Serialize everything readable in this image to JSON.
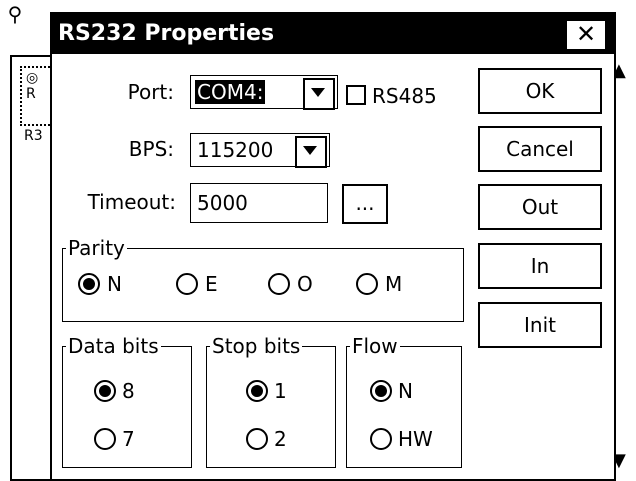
{
  "dialog": {
    "title": "RS232 Properties",
    "close_label": "✕"
  },
  "port": {
    "label": "Port:",
    "value": "COM4:"
  },
  "rs485": {
    "label": "RS485",
    "checked": false
  },
  "bps": {
    "label": "BPS:",
    "value": "115200"
  },
  "timeout": {
    "label": "Timeout:",
    "value": "5000",
    "browse_label": "..."
  },
  "buttons": {
    "ok": "OK",
    "cancel": "Cancel",
    "out": "Out",
    "in": "In",
    "init": "Init"
  },
  "parity": {
    "title": "Parity",
    "options": [
      "N",
      "E",
      "O",
      "M"
    ],
    "selected": "N"
  },
  "data_bits": {
    "title": "Data bits",
    "options": [
      "8",
      "7"
    ],
    "selected": "8"
  },
  "stop_bits": {
    "title": "Stop bits",
    "options": [
      "1",
      "2"
    ],
    "selected": "1"
  },
  "flow": {
    "title": "Flow",
    "options": [
      "N",
      "HW"
    ],
    "selected": "N"
  },
  "background": {
    "item_label_1": "R",
    "item_label_2": "R3"
  }
}
